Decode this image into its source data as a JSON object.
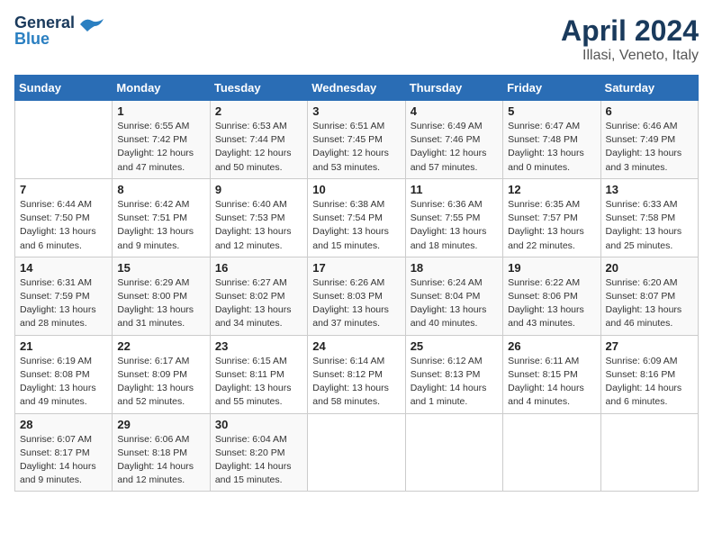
{
  "header": {
    "logo_line1": "General",
    "logo_line2": "Blue",
    "title": "April 2024",
    "subtitle": "Illasi, Veneto, Italy"
  },
  "calendar": {
    "days_of_week": [
      "Sunday",
      "Monday",
      "Tuesday",
      "Wednesday",
      "Thursday",
      "Friday",
      "Saturday"
    ],
    "weeks": [
      [
        {
          "num": "",
          "info": ""
        },
        {
          "num": "1",
          "info": "Sunrise: 6:55 AM\nSunset: 7:42 PM\nDaylight: 12 hours\nand 47 minutes."
        },
        {
          "num": "2",
          "info": "Sunrise: 6:53 AM\nSunset: 7:44 PM\nDaylight: 12 hours\nand 50 minutes."
        },
        {
          "num": "3",
          "info": "Sunrise: 6:51 AM\nSunset: 7:45 PM\nDaylight: 12 hours\nand 53 minutes."
        },
        {
          "num": "4",
          "info": "Sunrise: 6:49 AM\nSunset: 7:46 PM\nDaylight: 12 hours\nand 57 minutes."
        },
        {
          "num": "5",
          "info": "Sunrise: 6:47 AM\nSunset: 7:48 PM\nDaylight: 13 hours\nand 0 minutes."
        },
        {
          "num": "6",
          "info": "Sunrise: 6:46 AM\nSunset: 7:49 PM\nDaylight: 13 hours\nand 3 minutes."
        }
      ],
      [
        {
          "num": "7",
          "info": "Sunrise: 6:44 AM\nSunset: 7:50 PM\nDaylight: 13 hours\nand 6 minutes."
        },
        {
          "num": "8",
          "info": "Sunrise: 6:42 AM\nSunset: 7:51 PM\nDaylight: 13 hours\nand 9 minutes."
        },
        {
          "num": "9",
          "info": "Sunrise: 6:40 AM\nSunset: 7:53 PM\nDaylight: 13 hours\nand 12 minutes."
        },
        {
          "num": "10",
          "info": "Sunrise: 6:38 AM\nSunset: 7:54 PM\nDaylight: 13 hours\nand 15 minutes."
        },
        {
          "num": "11",
          "info": "Sunrise: 6:36 AM\nSunset: 7:55 PM\nDaylight: 13 hours\nand 18 minutes."
        },
        {
          "num": "12",
          "info": "Sunrise: 6:35 AM\nSunset: 7:57 PM\nDaylight: 13 hours\nand 22 minutes."
        },
        {
          "num": "13",
          "info": "Sunrise: 6:33 AM\nSunset: 7:58 PM\nDaylight: 13 hours\nand 25 minutes."
        }
      ],
      [
        {
          "num": "14",
          "info": "Sunrise: 6:31 AM\nSunset: 7:59 PM\nDaylight: 13 hours\nand 28 minutes."
        },
        {
          "num": "15",
          "info": "Sunrise: 6:29 AM\nSunset: 8:00 PM\nDaylight: 13 hours\nand 31 minutes."
        },
        {
          "num": "16",
          "info": "Sunrise: 6:27 AM\nSunset: 8:02 PM\nDaylight: 13 hours\nand 34 minutes."
        },
        {
          "num": "17",
          "info": "Sunrise: 6:26 AM\nSunset: 8:03 PM\nDaylight: 13 hours\nand 37 minutes."
        },
        {
          "num": "18",
          "info": "Sunrise: 6:24 AM\nSunset: 8:04 PM\nDaylight: 13 hours\nand 40 minutes."
        },
        {
          "num": "19",
          "info": "Sunrise: 6:22 AM\nSunset: 8:06 PM\nDaylight: 13 hours\nand 43 minutes."
        },
        {
          "num": "20",
          "info": "Sunrise: 6:20 AM\nSunset: 8:07 PM\nDaylight: 13 hours\nand 46 minutes."
        }
      ],
      [
        {
          "num": "21",
          "info": "Sunrise: 6:19 AM\nSunset: 8:08 PM\nDaylight: 13 hours\nand 49 minutes."
        },
        {
          "num": "22",
          "info": "Sunrise: 6:17 AM\nSunset: 8:09 PM\nDaylight: 13 hours\nand 52 minutes."
        },
        {
          "num": "23",
          "info": "Sunrise: 6:15 AM\nSunset: 8:11 PM\nDaylight: 13 hours\nand 55 minutes."
        },
        {
          "num": "24",
          "info": "Sunrise: 6:14 AM\nSunset: 8:12 PM\nDaylight: 13 hours\nand 58 minutes."
        },
        {
          "num": "25",
          "info": "Sunrise: 6:12 AM\nSunset: 8:13 PM\nDaylight: 14 hours\nand 1 minute."
        },
        {
          "num": "26",
          "info": "Sunrise: 6:11 AM\nSunset: 8:15 PM\nDaylight: 14 hours\nand 4 minutes."
        },
        {
          "num": "27",
          "info": "Sunrise: 6:09 AM\nSunset: 8:16 PM\nDaylight: 14 hours\nand 6 minutes."
        }
      ],
      [
        {
          "num": "28",
          "info": "Sunrise: 6:07 AM\nSunset: 8:17 PM\nDaylight: 14 hours\nand 9 minutes."
        },
        {
          "num": "29",
          "info": "Sunrise: 6:06 AM\nSunset: 8:18 PM\nDaylight: 14 hours\nand 12 minutes."
        },
        {
          "num": "30",
          "info": "Sunrise: 6:04 AM\nSunset: 8:20 PM\nDaylight: 14 hours\nand 15 minutes."
        },
        {
          "num": "",
          "info": ""
        },
        {
          "num": "",
          "info": ""
        },
        {
          "num": "",
          "info": ""
        },
        {
          "num": "",
          "info": ""
        }
      ]
    ]
  }
}
